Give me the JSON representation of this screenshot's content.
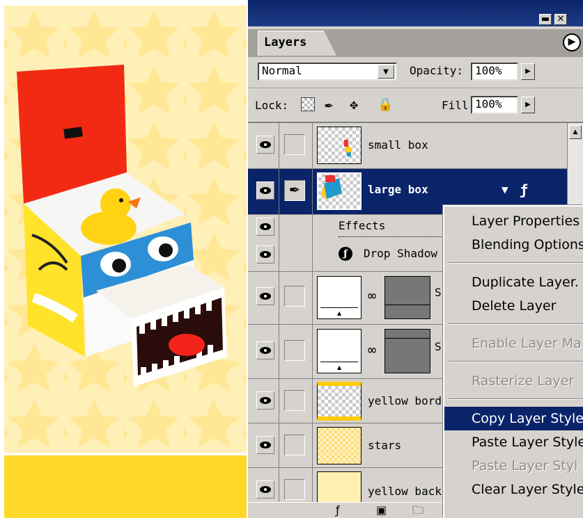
{
  "panel": {
    "tab_label": "Layers",
    "blend_mode": "Normal",
    "opacity_label": "Opacity:",
    "opacity_value": "100%",
    "lock_label": "Lock:",
    "fill_label": "Fill:",
    "fill_value": "100%"
  },
  "layers": [
    {
      "name": "small box",
      "visible": true,
      "selected": false
    },
    {
      "name": "large box",
      "visible": true,
      "selected": true,
      "has_effects": true
    },
    {
      "name": "Effects",
      "sub": true
    },
    {
      "name": "Drop Shadow",
      "sub": true
    },
    {
      "name": "S",
      "visible": true,
      "masked": true
    },
    {
      "name": "S",
      "visible": true,
      "masked": true
    },
    {
      "name": "yellow borde",
      "visible": true
    },
    {
      "name": "stars",
      "visible": true
    },
    {
      "name": "yellow backc",
      "visible": true
    }
  ],
  "context_menu": {
    "items": [
      {
        "label": "Layer Properties",
        "state": "enabled"
      },
      {
        "label": "Blending Options",
        "state": "enabled"
      },
      {
        "label": "Duplicate Layer.",
        "state": "enabled"
      },
      {
        "label": "Delete Layer",
        "state": "enabled"
      },
      {
        "label": "Enable Layer Ma",
        "state": "disabled"
      },
      {
        "label": "Rasterize Layer",
        "state": "disabled"
      },
      {
        "label": "Copy Layer Style",
        "state": "highlighted"
      },
      {
        "label": "Paste Layer Style",
        "state": "enabled"
      },
      {
        "label": "Paste Layer Styl",
        "state": "disabled"
      },
      {
        "label": "Clear Layer Style",
        "state": "enabled"
      }
    ]
  },
  "colors": {
    "title_bar": "#0a246a",
    "selection": "#0a246a",
    "panel_bg": "#d6d3ce",
    "canvas_yellow": "#ffd92a",
    "canvas_light_yellow": "#fff0b8"
  },
  "icons": [
    "eye-icon",
    "brush-icon",
    "link-icon",
    "fx-icon",
    "lock-icon",
    "move-icon",
    "checker-icon",
    "menu-arrow-icon",
    "dropdown-arrow-icon",
    "trash-icon",
    "new-layer-icon",
    "folder-icon",
    "mask-icon",
    "adjustment-icon"
  ]
}
